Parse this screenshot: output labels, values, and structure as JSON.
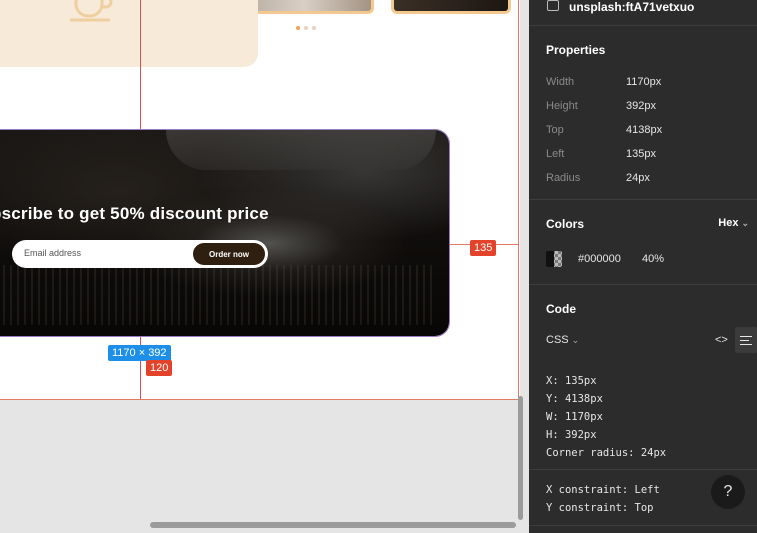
{
  "canvas": {
    "banner_title": "bscribe to get 50% discount price",
    "email_placeholder": "Email address",
    "order_button": "Order now",
    "size_label": "1170 × 392",
    "badge_left": "120",
    "badge_right": "135"
  },
  "panel": {
    "layer_name": "unsplash:ftA71vetxuo",
    "properties_title": "Properties",
    "properties": [
      {
        "label": "Width",
        "value": "1170px"
      },
      {
        "label": "Height",
        "value": "392px"
      },
      {
        "label": "Top",
        "value": "4138px"
      },
      {
        "label": "Left",
        "value": "135px"
      },
      {
        "label": "Radius",
        "value": "24px"
      }
    ],
    "colors_title": "Colors",
    "color_format": "Hex",
    "color": {
      "hex": "#000000",
      "opacity": "40%"
    },
    "code_title": "Code",
    "code_language": "CSS",
    "code_lines": [
      "X: 135px",
      "Y: 4138px",
      "W: 1170px",
      "H: 392px",
      "Corner radius: 24px"
    ],
    "constraints": [
      "X constraint: Left",
      "Y constraint: Top"
    ],
    "help": "?"
  }
}
